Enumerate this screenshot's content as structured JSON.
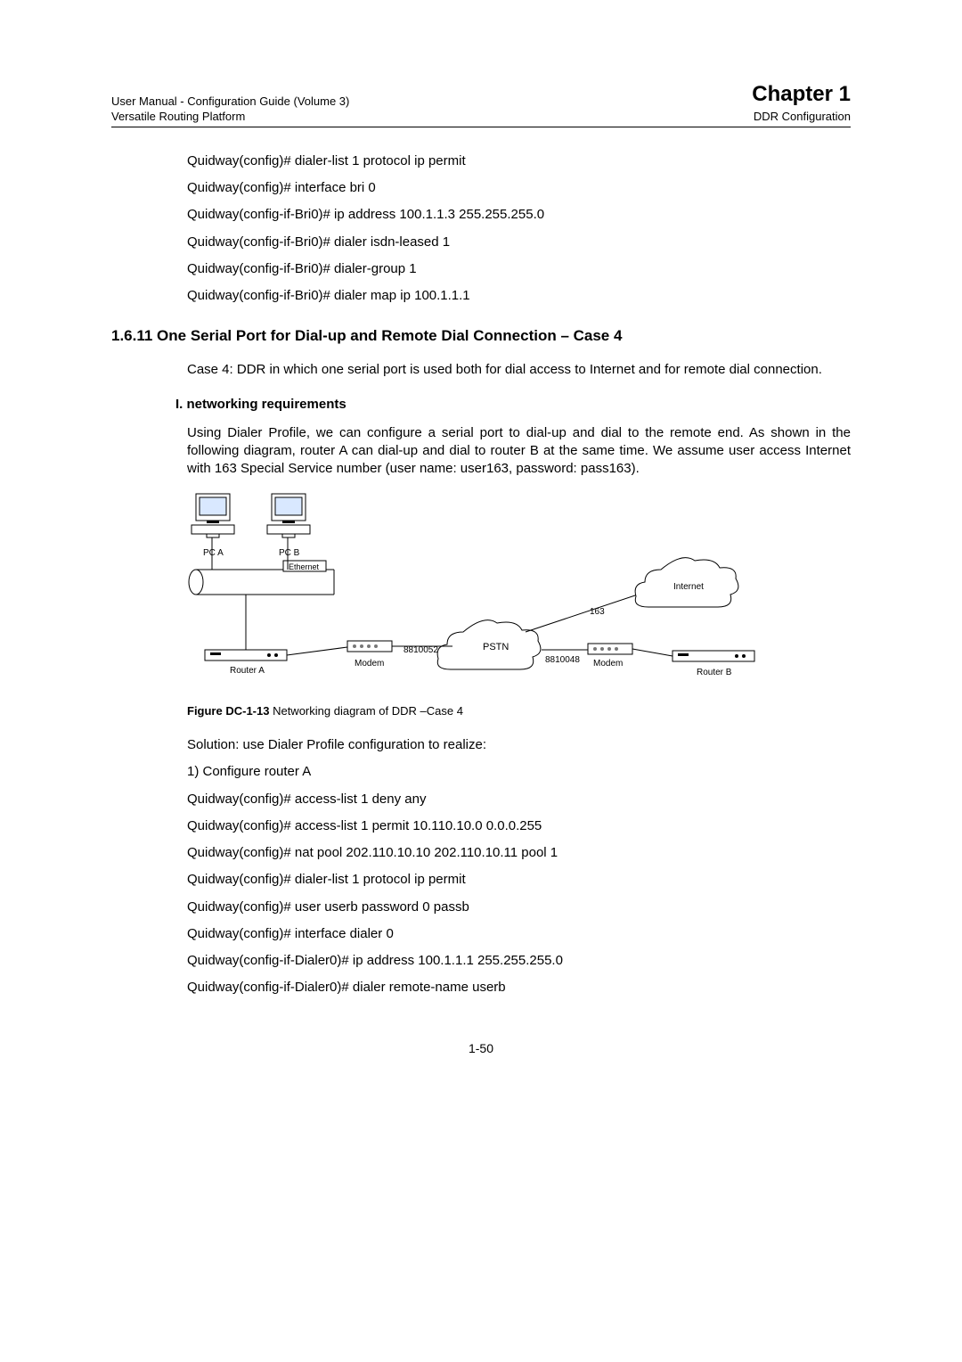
{
  "header": {
    "left_top": "User Manual - Configuration Guide (Volume 3)",
    "left_bottom": "Versatile Routing Platform",
    "right_top": "Chapter 1",
    "right_bottom": "DDR Configuration"
  },
  "cmds_top": [
    "Quidway(config)# dialer-list 1 protocol ip permit",
    "Quidway(config)# interface bri 0",
    "Quidway(config-if-Bri0)# ip address 100.1.1.3 255.255.255.0",
    "Quidway(config-if-Bri0)# dialer isdn-leased 1",
    "Quidway(config-if-Bri0)# dialer-group 1",
    "Quidway(config-if-Bri0)# dialer map ip 100.1.1.1"
  ],
  "section": {
    "number_title": "1.6.11  One Serial Port for Dial-up and Remote Dial Connection – Case 4",
    "case_text": "Case 4: DDR in which one serial port is used both for dial access to Internet and for remote dial connection.",
    "subheading": "I. networking requirements",
    "req_text": "Using Dialer Profile, we can configure a serial port to dial-up and dial to the remote end. As shown in the following diagram, router A can dial-up and dial to router B at the same time. We assume user access Internet with 163 Special Service number (user name: user163, password: pass163)."
  },
  "diagram": {
    "pc_a": "PC A",
    "pc_b": "PC B",
    "ethernet": "Ethernet",
    "router_a": "Router A",
    "modem_left": "Modem",
    "num_left": "8810052",
    "pstn": "PSTN",
    "num_right": "8810048",
    "modem_right": "Modem",
    "router_b": "Router B",
    "n163": "163",
    "internet": "Internet"
  },
  "figure_caption": {
    "prefix": "Figure DC-1-13",
    "text": "  Networking diagram of DDR –Case 4"
  },
  "solution_line": "Solution: use Dialer Profile configuration to realize:",
  "list1": "1)    Configure router A",
  "cmds_bottom": [
    "Quidway(config)# access-list 1 deny any",
    "Quidway(config)# access-list 1 permit 10.110.10.0 0.0.0.255",
    "Quidway(config)# nat pool 202.110.10.10 202.110.10.11 pool 1",
    "Quidway(config)# dialer-list 1 protocol ip permit",
    "Quidway(config)# user userb password 0 passb",
    "Quidway(config)# interface dialer 0",
    "Quidway(config-if-Dialer0)# ip address 100.1.1.1 255.255.255.0",
    "Quidway(config-if-Dialer0)# dialer remote-name userb"
  ],
  "page_num": "1-50"
}
